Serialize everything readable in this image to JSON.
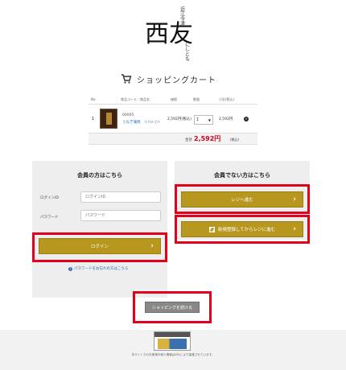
{
  "logo": {
    "small_text": "近江今津",
    "main_text": "西友",
    "kana_text": "にしとも"
  },
  "page_title": "ショッピングカート",
  "table": {
    "headers": [
      "No.",
      "商品コード／商品名",
      "価格",
      "数量",
      "小計(税込)"
    ],
    "rows": [
      {
        "no": "1",
        "code": "00005",
        "name": "うなぎ蒲焼　＜ｲﾄﾊｰﾌ＞",
        "price": "2,592円(税込)",
        "qty": "1",
        "subtotal": "2,592円"
      }
    ],
    "total_label": "合計",
    "total_value": "2,592円",
    "total_tax": "(税込)"
  },
  "member": {
    "title": "会員の方はこちら",
    "login_id_label": "ログインID",
    "login_id_placeholder": "ログインID",
    "password_label": "パスワード",
    "password_placeholder": "パスワード",
    "login_button": "ログイン",
    "forgot_link": "パスワードをお忘れの方はこちら"
  },
  "guest": {
    "title": "会員でない方はこちら",
    "checkout_button": "レジへ進む",
    "register_button": "新規登録してからレジに進む"
  },
  "continue_button": "ショッピングを続ける",
  "footer": {
    "text": "本サイトでのお客様の個人情報はSSLにより保護されています。"
  }
}
